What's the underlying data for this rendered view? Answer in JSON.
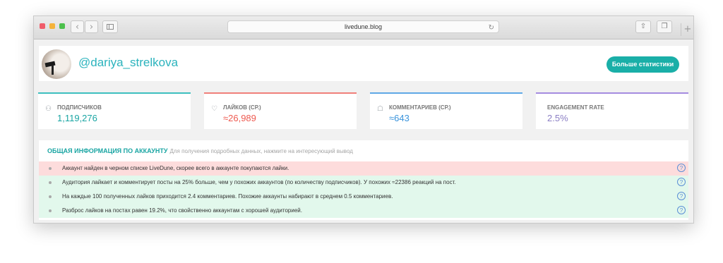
{
  "browser": {
    "url": "livedune.blog",
    "back_icon": "chevron-left-icon",
    "forward_icon": "chevron-right-icon",
    "share_icon": "share-icon",
    "tabs_icon": "tabs-icon",
    "reload_icon": "reload-icon"
  },
  "profile": {
    "username": "@dariya_strelkova",
    "stats_button": "Больше статистики"
  },
  "stats": [
    {
      "label": "ПОДПИСЧИКОВ",
      "value": "1,119,276",
      "accent": "#3dbfbf",
      "value_color": "#1aa5a3",
      "icon": "users-icon"
    },
    {
      "label": "ЛАЙКОВ (СР.)",
      "value": "≈26,989",
      "accent": "#f0807a",
      "value_color": "#ee5a50",
      "icon": "heart-icon"
    },
    {
      "label": "КОММЕНТАРИЕВ (СР.)",
      "value": "≈643",
      "accent": "#5fa8e6",
      "value_color": "#3a94dc",
      "icon": "comments-icon"
    },
    {
      "label": "ENGAGEMENT RATE",
      "value": "2.5%",
      "accent": "#a58be0",
      "value_color": "#8b7fc4",
      "icon": ""
    }
  ],
  "info": {
    "title": "ОБЩАЯ ИНФОРМАЦИЯ ПО АККАУНТУ",
    "hint": "Для получения подробных данных, нажмите на интересующий вывод",
    "rows": [
      {
        "text": "Аккаунт найден в черном списке LiveDune, скорее всего в аккаунте покупаются лайки.",
        "status": "bad",
        "bg": "#fddcdc"
      },
      {
        "text": "Аудитория лайкает и комментирует посты на 25% больше, чем у похожих аккаунтов (по количеству подписчиков). У похожих ≈22386 реакций на пост.",
        "status": "good",
        "bg": "#e2f8ec"
      },
      {
        "text": "На каждые 100 полученных лайков приходится 2.4 комментариев. Похожие аккаунты набирают в среднем 0.5 комментариев.",
        "status": "good",
        "bg": "#e2f8ec"
      },
      {
        "text": "Разброс лайков на постах равен 19.2%, что свойственно аккаунтам с хорошей аудиторией.",
        "status": "good",
        "bg": "#e2f8ec"
      }
    ],
    "help_glyph": "?"
  }
}
